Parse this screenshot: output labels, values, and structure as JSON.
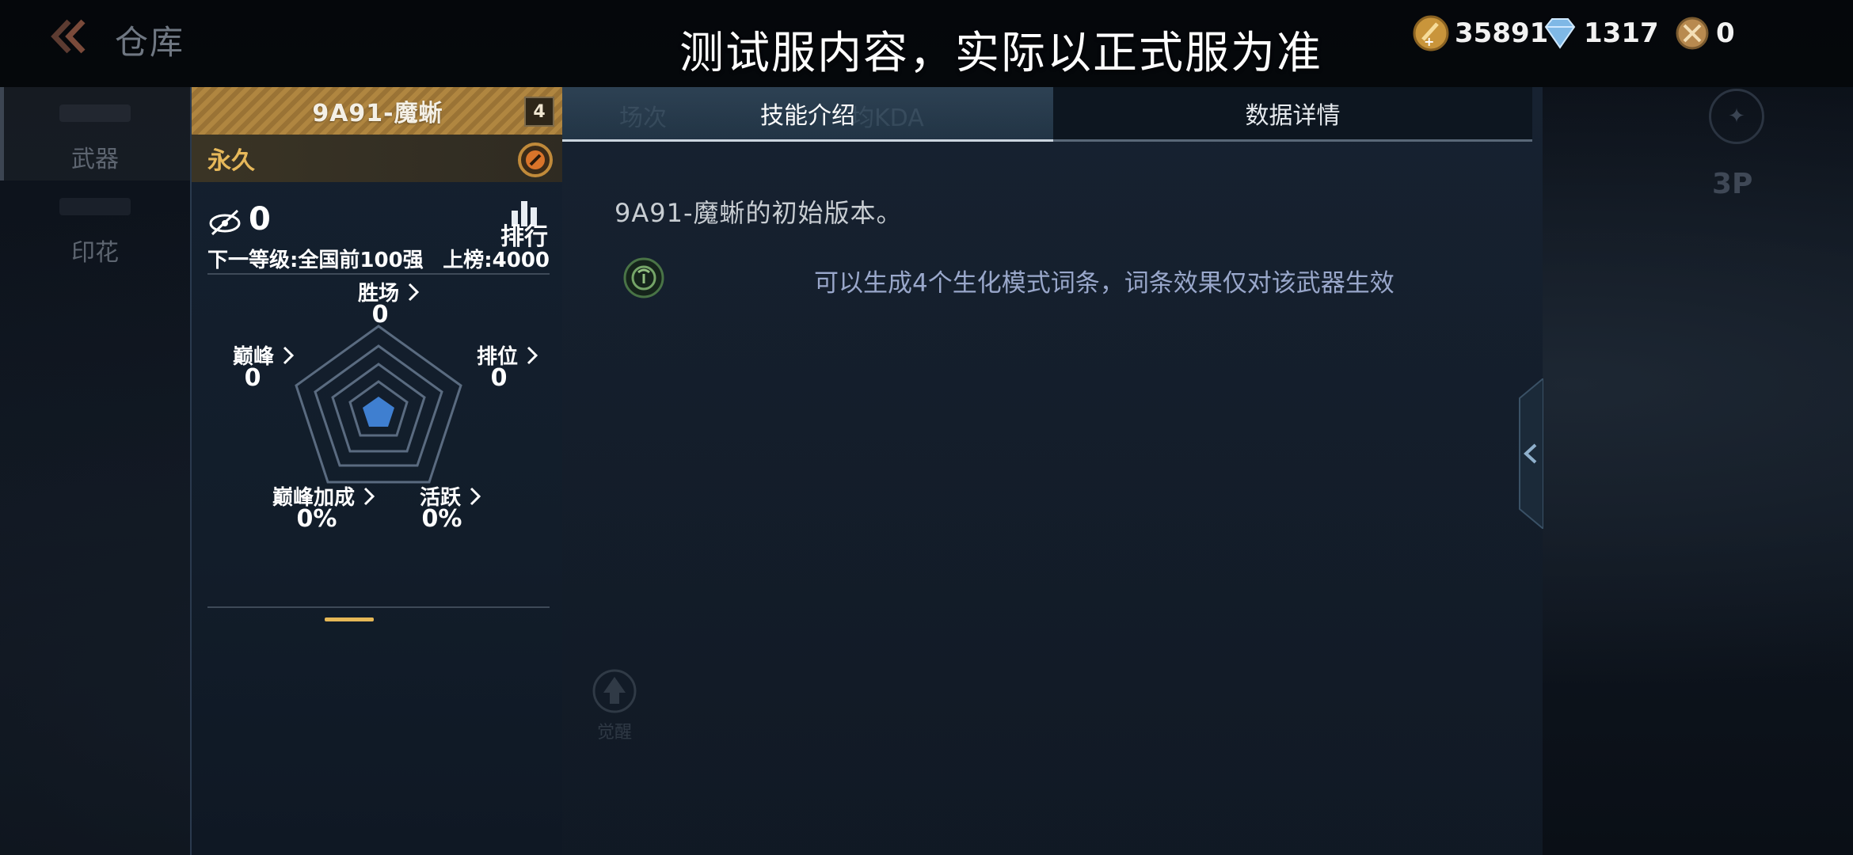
{
  "nav": {
    "title": "仓库"
  },
  "sidebar": {
    "items": [
      {
        "label": "武器"
      },
      {
        "label": "印花"
      }
    ]
  },
  "banner": {
    "text": "测试服内容，实际以正式服为准"
  },
  "currency": {
    "gold": "35891",
    "diamond": "1317",
    "token": "0"
  },
  "right_controls": {
    "view_label": "3P"
  },
  "weapon_card": {
    "title": "9A91-魔蜥",
    "level": "4",
    "duration": "永久",
    "kills": "0",
    "rank_label": "排行",
    "next_level": "下一等级:全国前100强",
    "rank_requirement": "上榜:4000",
    "radar": {
      "wins": {
        "label": "胜场",
        "value": "0"
      },
      "peak": {
        "label": "巅峰",
        "value": "0"
      },
      "ranked": {
        "label": "排位",
        "value": "0"
      },
      "peak_bonus": {
        "label": "巅峰加成",
        "value": "0%"
      },
      "active": {
        "label": "活跃",
        "value": "0%"
      }
    }
  },
  "tabs": {
    "skill": "技能介绍",
    "data": "数据详情"
  },
  "ghost_stats": {
    "matches": "场次",
    "avg_kda": "均KDA"
  },
  "description": "9A91-魔蜥的初始版本。",
  "skill": {
    "text": "可以生成4个生化模式词条，词条效果仅对该武器生效"
  },
  "awaken_label": "觉醒",
  "colors": {
    "accent_gold": "#e5b756",
    "skill_text": "#a7b6dc",
    "radar_core": "#3f7fd0"
  }
}
